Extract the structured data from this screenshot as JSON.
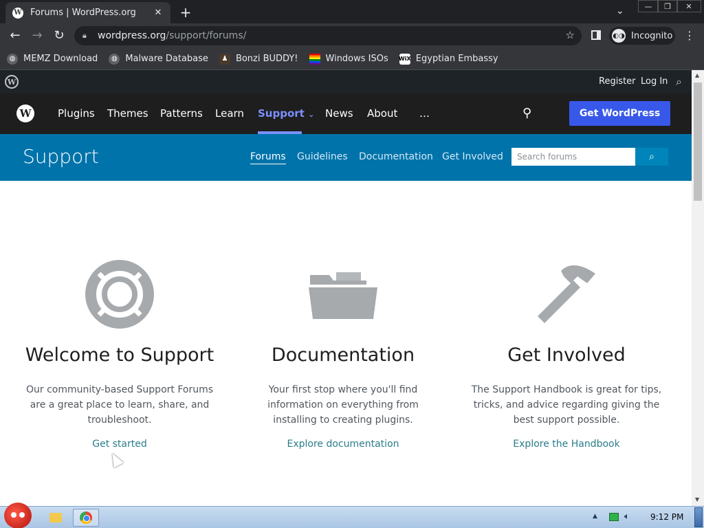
{
  "browser": {
    "tab_title": "Forums | WordPress.org",
    "url_host": "wordpress.org",
    "url_path": "/support/forums/",
    "incognito_label": "Incognito",
    "bookmarks": [
      {
        "label": "MEMZ Download",
        "icon": "globe-icon",
        "color": "#5f6368"
      },
      {
        "label": "Malware Database",
        "icon": "globe-icon",
        "color": "#5f6368"
      },
      {
        "label": "Bonzi BUDDY!",
        "icon": "bonzi-icon",
        "color": "#7b3fa0"
      },
      {
        "label": "Windows ISOs",
        "icon": "rainbow-flag-icon",
        "color": "#e40303"
      },
      {
        "label": "Egyptian Embassy",
        "icon": "wix-icon",
        "color": "#ffffff"
      }
    ]
  },
  "wp_top": {
    "register": "Register",
    "login": "Log In"
  },
  "nav": {
    "items": [
      "Plugins",
      "Themes",
      "Patterns",
      "Learn",
      "Support",
      "News",
      "About",
      "…"
    ],
    "active": "Support",
    "cta": "Get WordPress"
  },
  "support": {
    "title": "Support",
    "links": [
      "Forums",
      "Guidelines",
      "Documentation",
      "Get Involved"
    ],
    "current": "Forums",
    "search_placeholder": "Search forums"
  },
  "columns": [
    {
      "icon": "lifebuoy-icon",
      "title": "Welcome to Support",
      "text": "Our community-based Support Forums are a great place to learn, share, and troubleshoot.",
      "link": "Get started"
    },
    {
      "icon": "folder-icon",
      "title": "Documentation",
      "text": "Your first stop where you'll find information on everything from installing to creating plugins.",
      "link": "Explore documentation"
    },
    {
      "icon": "hammer-icon",
      "title": "Get Involved",
      "text": "The Support Handbook is great for tips, tricks, and advice regarding giving the best support possible.",
      "link": "Explore the Handbook"
    }
  ],
  "taskbar": {
    "clock": "9:12 PM"
  },
  "colors": {
    "nav_active": "#7b90ff",
    "cta": "#3858e9",
    "support_bar": "#0073aa",
    "link": "#2a7d8a",
    "icon_gray": "#a7aaad"
  }
}
